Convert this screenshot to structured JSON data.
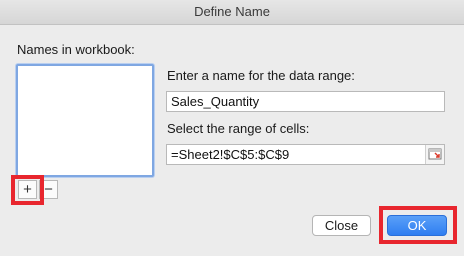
{
  "window": {
    "title": "Define Name"
  },
  "names_panel": {
    "label": "Names in workbook:",
    "add_label": "+",
    "remove_label": "−"
  },
  "name_field": {
    "prompt": "Enter a name for the data range:",
    "value": "Sales_Quantity"
  },
  "range_field": {
    "prompt": "Select the range of cells:",
    "value": "=Sheet2!$C$5:$C$9",
    "collapse_icon": "range-select-icon"
  },
  "buttons": {
    "close_label": "Close",
    "ok_label": "OK"
  },
  "colors": {
    "highlight": "#e8262e",
    "accent": "#2f7ef1"
  }
}
